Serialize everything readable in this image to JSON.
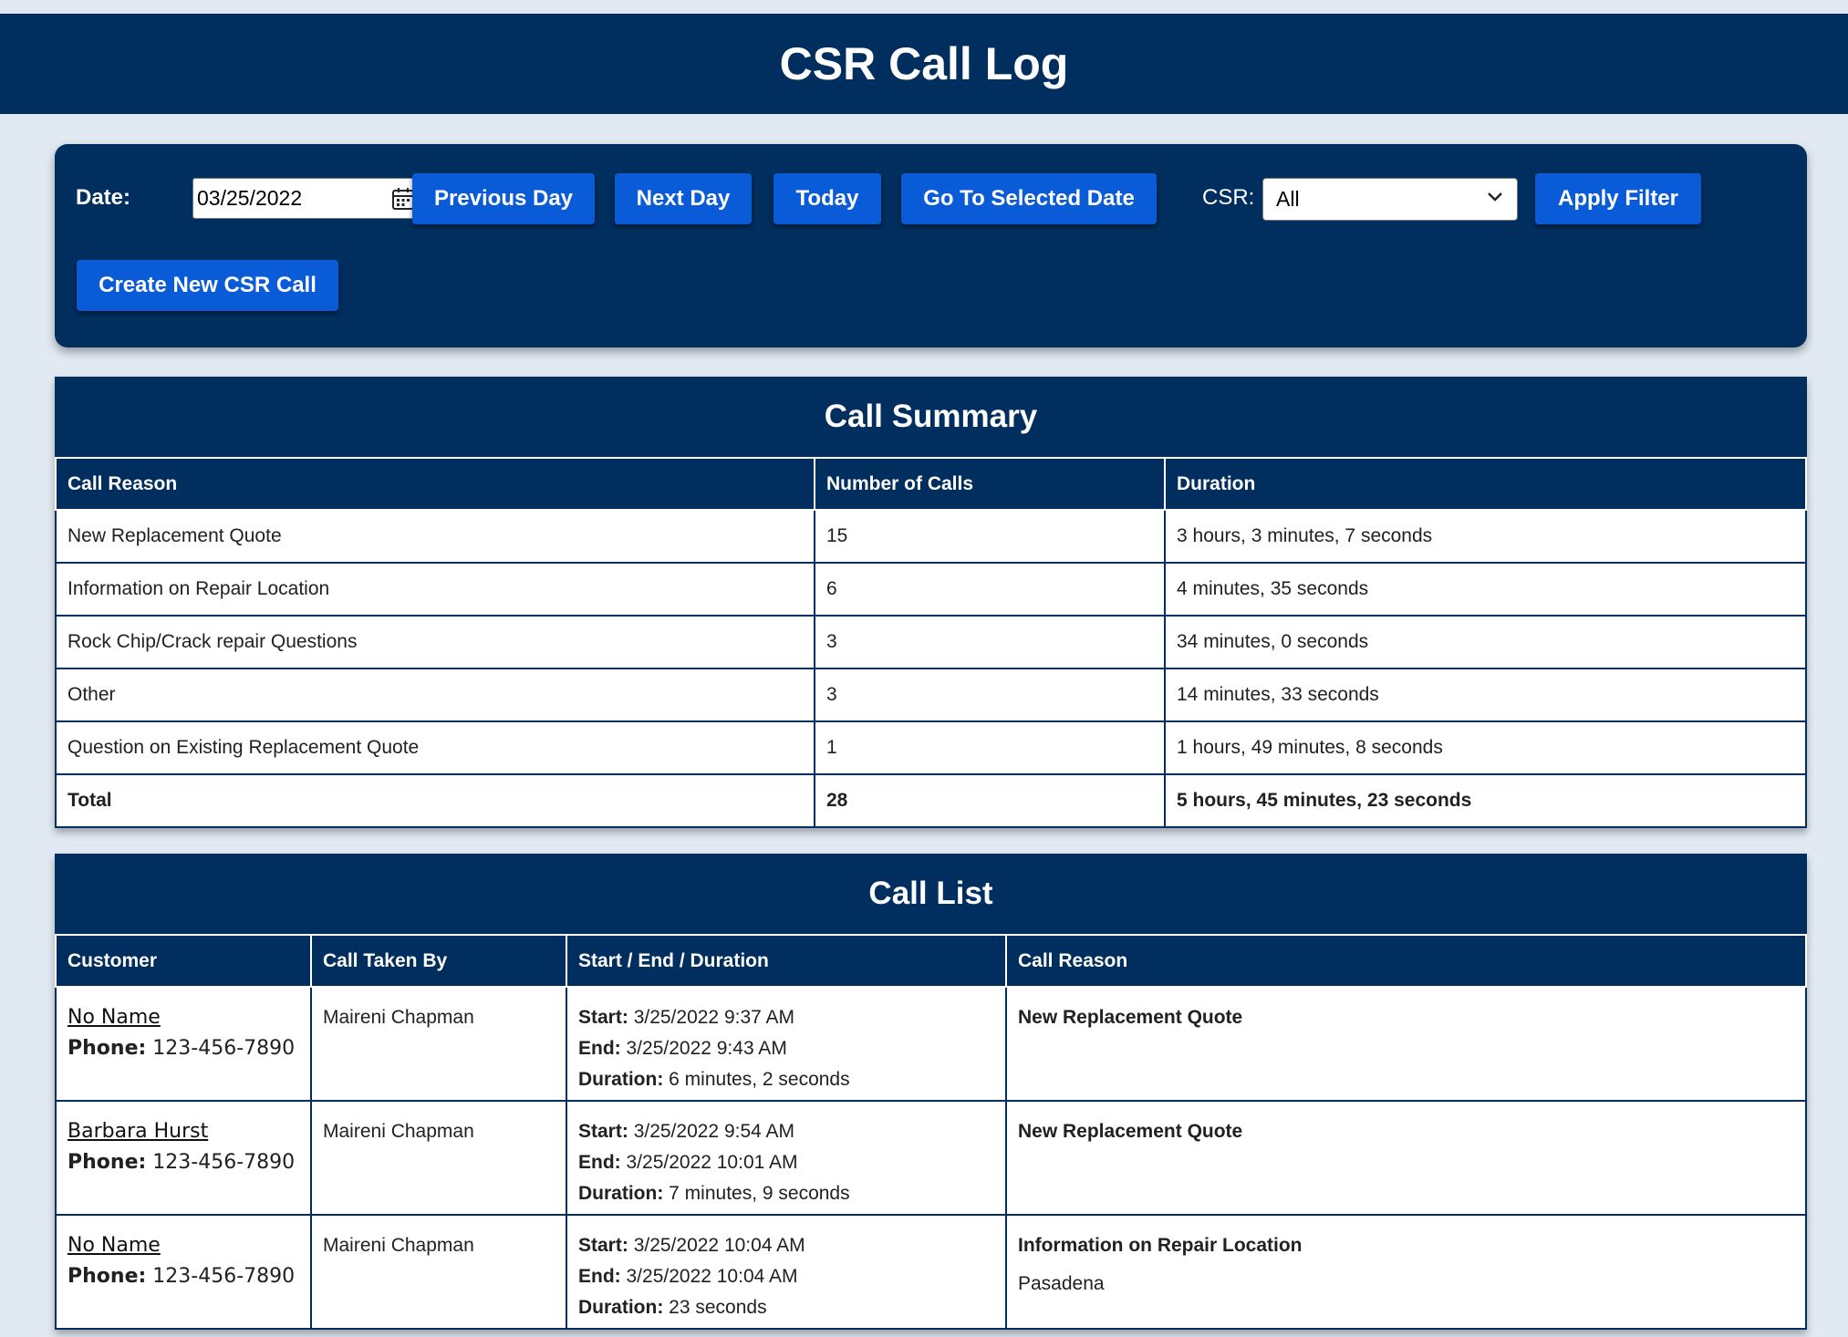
{
  "header": {
    "title": "CSR Call Log"
  },
  "controls": {
    "date_label": "Date:",
    "date_value": "03/25/2022",
    "prev_day": "Previous Day",
    "next_day": "Next Day",
    "today": "Today",
    "go_to_date": "Go To Selected Date",
    "csr_label": "CSR:",
    "csr_value": "All",
    "apply_filter": "Apply Filter",
    "create_call": "Create New CSR Call"
  },
  "summary": {
    "title": "Call Summary",
    "columns": [
      "Call Reason",
      "Number of Calls",
      "Duration"
    ],
    "rows": [
      [
        "New Replacement Quote",
        "15",
        "3 hours, 3 minutes, 7 seconds"
      ],
      [
        "Information on Repair Location",
        "6",
        "4 minutes, 35 seconds"
      ],
      [
        "Rock Chip/Crack repair Questions",
        "3",
        "34 minutes, 0 seconds"
      ],
      [
        "Other",
        "3",
        "14 minutes, 33 seconds"
      ],
      [
        "Question on Existing Replacement Quote",
        "1",
        "1 hours, 49 minutes, 8 seconds"
      ]
    ],
    "total": [
      "Total",
      "28",
      "5 hours, 45 minutes, 23 seconds"
    ]
  },
  "call_list": {
    "title": "Call List",
    "columns": [
      "Customer",
      "Call Taken By",
      "Start / End / Duration",
      "Call Reason"
    ],
    "labels": {
      "phone": "Phone:",
      "start": "Start:",
      "end": "End:",
      "duration": "Duration:"
    },
    "rows": [
      {
        "customer": "No Name",
        "phone": "123-456-7890",
        "taken_by": "Maireni Chapman",
        "start": "3/25/2022 9:37 AM",
        "end": "3/25/2022 9:43 AM",
        "duration": "6 minutes, 2 seconds",
        "reason": "New Replacement Quote",
        "detail": ""
      },
      {
        "customer": "Barbara Hurst",
        "phone": "123-456-7890",
        "taken_by": "Maireni Chapman",
        "start": "3/25/2022 9:54 AM",
        "end": "3/25/2022 10:01 AM",
        "duration": "7 minutes, 9 seconds",
        "reason": "New Replacement Quote",
        "detail": ""
      },
      {
        "customer": "No Name",
        "phone": "123-456-7890",
        "taken_by": "Maireni Chapman",
        "start": "3/25/2022 10:04 AM",
        "end": "3/25/2022 10:04 AM",
        "duration": "23 seconds",
        "reason": "Information on Repair Location",
        "detail": "Pasadena"
      }
    ]
  }
}
